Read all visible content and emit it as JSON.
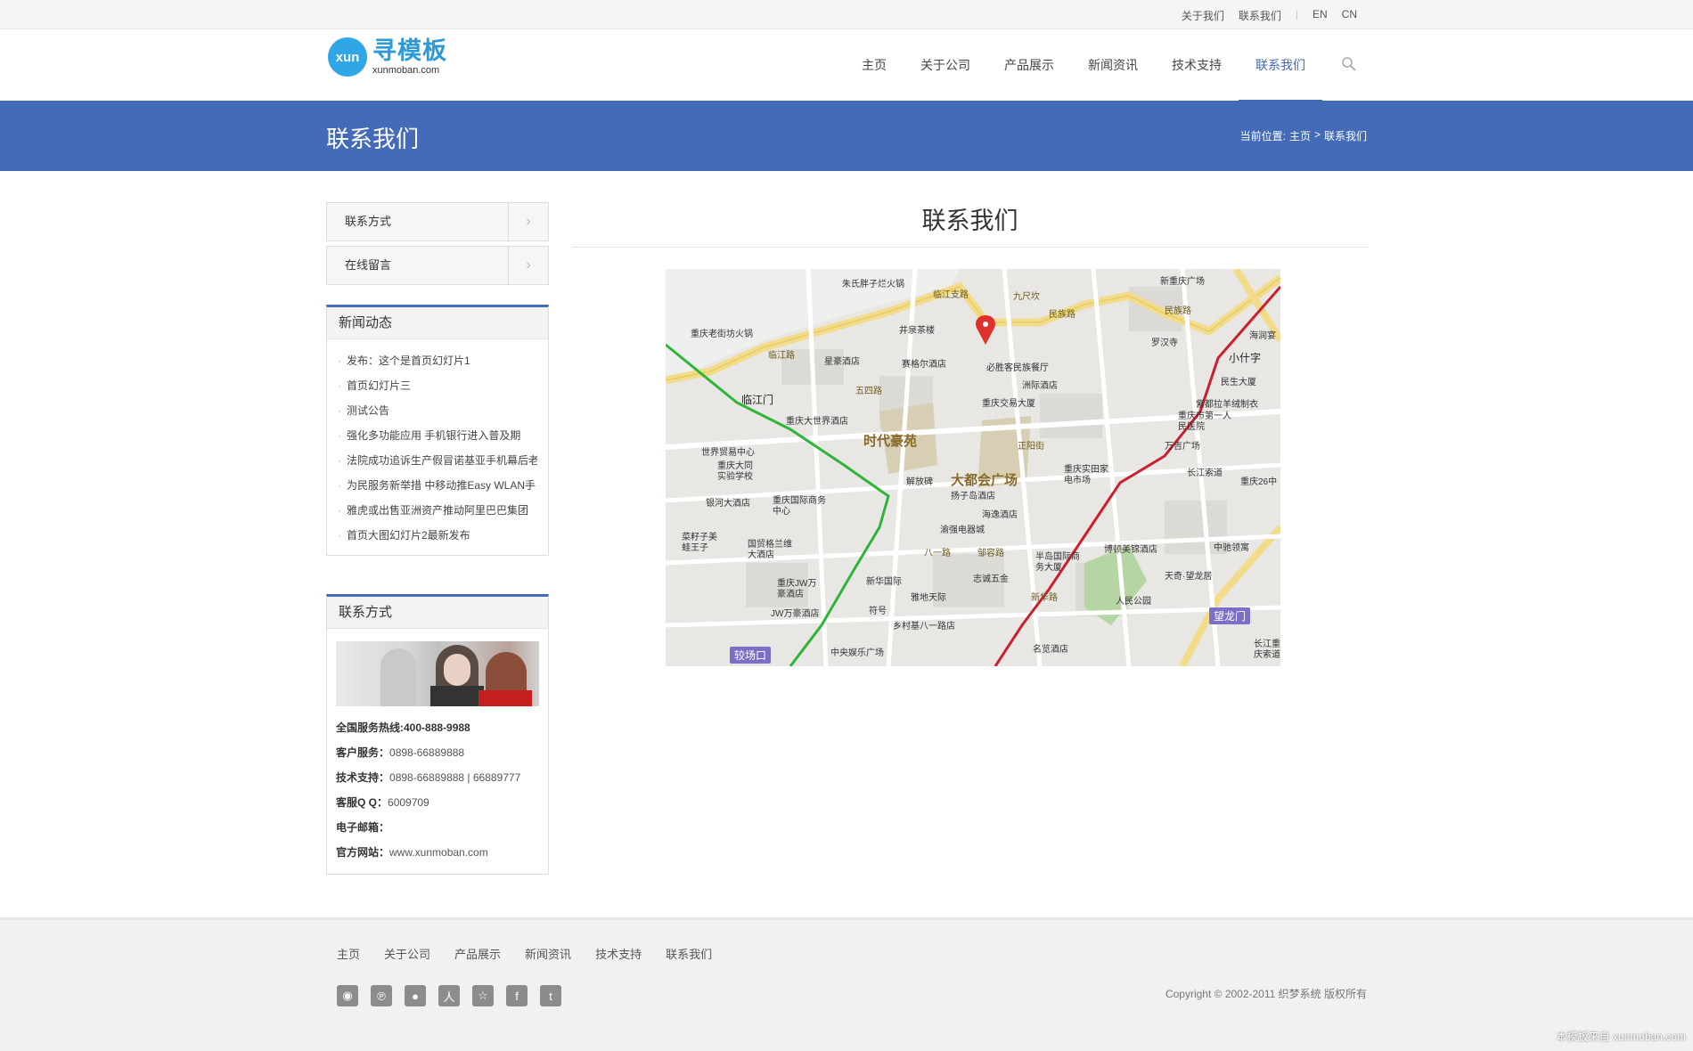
{
  "topbar": {
    "about": "关于我们",
    "contact": "联系我们",
    "en": "EN",
    "cn": "CN"
  },
  "logo": {
    "badge": "xun",
    "cn": "寻模板",
    "en": "xunmoban.com"
  },
  "nav": [
    {
      "label": "主页",
      "active": false
    },
    {
      "label": "关于公司",
      "active": false
    },
    {
      "label": "产品展示",
      "active": false
    },
    {
      "label": "新闻资讯",
      "active": false
    },
    {
      "label": "技术支持",
      "active": false
    },
    {
      "label": "联系我们",
      "active": true
    }
  ],
  "banner": {
    "title": "联系我们",
    "crumb_prefix": "当前位置:",
    "crumb_home": "主页",
    "crumb_sep": ">",
    "crumb_current": "联系我们"
  },
  "sidemenu": [
    "联系方式",
    "在线留言"
  ],
  "news": {
    "title": "新闻动态",
    "items": [
      "发布：这个是首页幻灯片1",
      "首页幻灯片三",
      "测试公告",
      "强化多功能应用 手机银行进入普及期",
      "法院成功追诉生产假冒诺基亚手机幕后老",
      "为民服务新举措 中移动推Easy WLAN手",
      "雅虎或出售亚洲资产推动阿里巴巴集团",
      "首页大图幻灯片2最新发布"
    ]
  },
  "contact": {
    "title": "联系方式",
    "hotline_label": "全国服务热线:400-888-9988",
    "service_label": "客户服务：",
    "service": "0898-66889888",
    "tech_label": "技术支持：",
    "tech": "0898-66889888 | 66889777",
    "qq_label": "客服Q Q：",
    "qq": "6009709",
    "email_label": "电子邮箱：",
    "email": "",
    "site_label": "官方网站：",
    "site": "www.xunmoban.com"
  },
  "main": {
    "title": "联系我们"
  },
  "map": {
    "labels": {
      "l1": "朱氏胖子烂火锅",
      "l2": "临江支路",
      "l3": "九尺坎",
      "l4": "新重庆广场",
      "l5": "民族路",
      "l6": "重庆老街坊火锅",
      "l7": "井泉茶楼",
      "l8": "民族路",
      "l9": "罗汉寺",
      "l10": "海润宴",
      "l11": "临江路",
      "l12": "星豪酒店",
      "l13": "赛格尔酒店",
      "l14": "必胜客民族餐厅",
      "l15": "小什字",
      "l16": "民生大厦",
      "l17": "临江门",
      "l18": "五四路",
      "l19": "洲际酒店",
      "l20": "重庆交易大厦",
      "l21": "紫都拉羊绒制衣",
      "l22": "重庆大世界酒店",
      "l23": "重庆市第一人民医院",
      "l24": "时代豪苑",
      "l25": "世界贸易中心",
      "l26": "万吉广场",
      "l27": "重庆大同实验学校",
      "l28": "大都会广场",
      "l29": "重庆实田家电市场",
      "l30": "长江索道",
      "l31": "重庆26中",
      "l32": "解放碑",
      "l33": "扬子岛酒店",
      "l34": "银河大酒店",
      "l35": "重庆国际商务中心",
      "l36": "海逸酒店",
      "l37": "渝强电器城",
      "l38": "菜籽子美蛙王子",
      "l39": "国贸格兰维大酒店",
      "l40": "博顿美锦酒店",
      "l41": "中驰领寓",
      "l42": "半岛国际商务大厦",
      "l43": "天奇·望龙居",
      "l44": "新华国际",
      "l45": "志诚五金",
      "l46": "重庆JW万豪酒店",
      "l47": "雅地天际",
      "l48": "人民公园",
      "l49": "JW万豪酒店",
      "l50": "符号",
      "l51": "乡村基八一路店",
      "l52": "望龙门",
      "l53": "中央娱乐广场",
      "l54": "名览酒店",
      "l55": "较场口",
      "l56": "长江重庆索道",
      "l57": "八一路",
      "l58": "邹容路",
      "l59": "新华路",
      "l60": "正阳街"
    }
  },
  "footer": {
    "nav": [
      "主页",
      "关于公司",
      "产品展示",
      "新闻资讯",
      "技术支持",
      "联系我们"
    ],
    "social": [
      "weibo-icon",
      "pinterest-icon",
      "chat-icon",
      "renren-icon",
      "star-icon",
      "facebook-icon",
      "twitter-icon"
    ],
    "copyright": "Copyright © 2002-2011 织梦系统 版权所有",
    "watermark": "本模板来自 xunmoban.com"
  },
  "colors": {
    "accent": "#446bb8",
    "logo": "#2fa6e5"
  }
}
